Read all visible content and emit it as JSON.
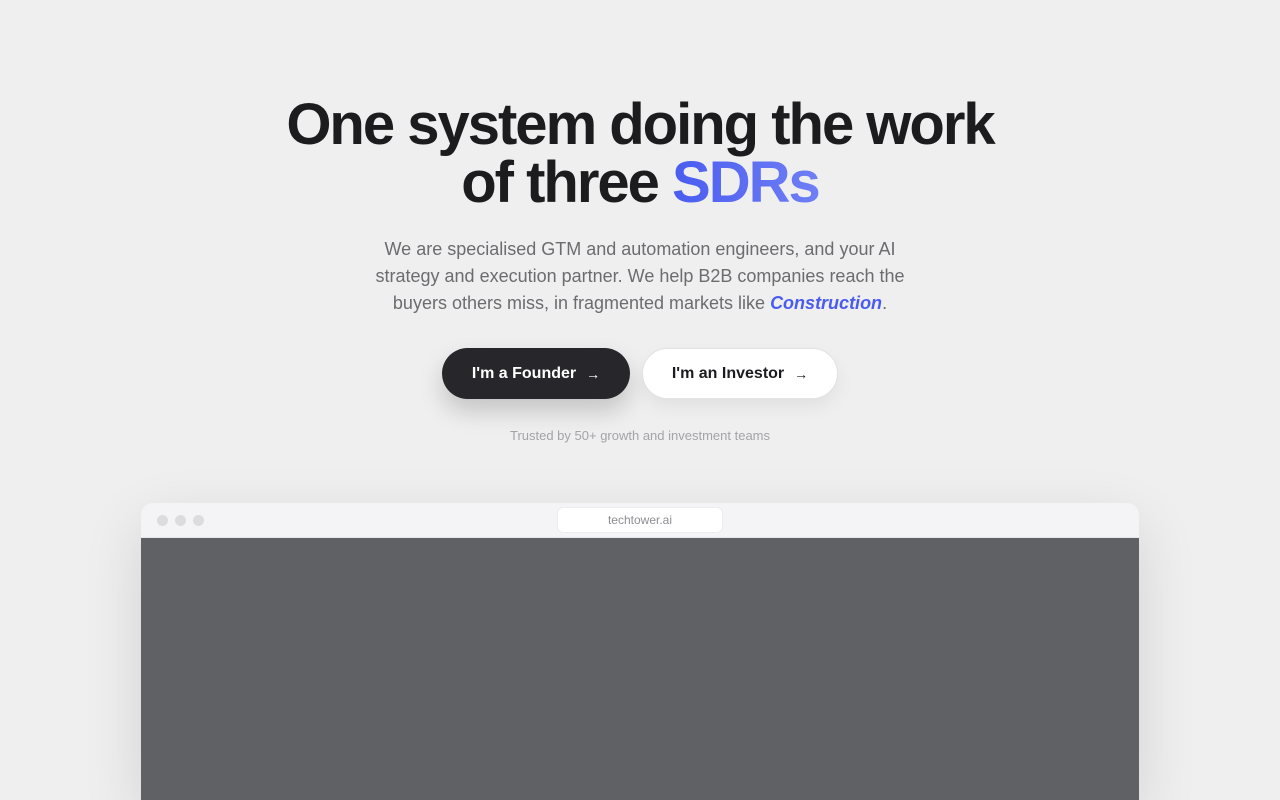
{
  "hero": {
    "headline_line1": "One system doing the work",
    "headline_line2_prefix": "of three ",
    "headline_accent": "SDRs",
    "subtitle_main": "We are specialised GTM and automation engineers, and your AI strategy and execution partner. We help B2B companies reach the buyers others miss, in fragmented markets like ",
    "subtitle_highlight": "Construction",
    "subtitle_end": "."
  },
  "cta": {
    "founder_label": "I'm a Founder",
    "investor_label": "I'm an Investor",
    "arrow_icon": "arrow-right-icon"
  },
  "trusted_text": "Trusted by 50+ growth and investment teams",
  "browser": {
    "url": "techtower.ai"
  },
  "colors": {
    "accent": "#4a5cf0",
    "background": "#efefef",
    "dark_button": "#27272b",
    "preview_body": "#606165"
  }
}
